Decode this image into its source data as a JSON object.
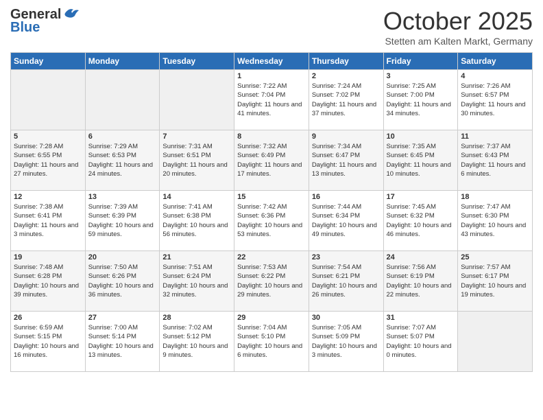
{
  "header": {
    "logo_general": "General",
    "logo_blue": "Blue",
    "month": "October 2025",
    "location": "Stetten am Kalten Markt, Germany"
  },
  "days_of_week": [
    "Sunday",
    "Monday",
    "Tuesday",
    "Wednesday",
    "Thursday",
    "Friday",
    "Saturday"
  ],
  "weeks": [
    [
      {
        "day": "",
        "sunrise": "",
        "sunset": "",
        "daylight": ""
      },
      {
        "day": "",
        "sunrise": "",
        "sunset": "",
        "daylight": ""
      },
      {
        "day": "",
        "sunrise": "",
        "sunset": "",
        "daylight": ""
      },
      {
        "day": "1",
        "sunrise": "Sunrise: 7:22 AM",
        "sunset": "Sunset: 7:04 PM",
        "daylight": "Daylight: 11 hours and 41 minutes."
      },
      {
        "day": "2",
        "sunrise": "Sunrise: 7:24 AM",
        "sunset": "Sunset: 7:02 PM",
        "daylight": "Daylight: 11 hours and 37 minutes."
      },
      {
        "day": "3",
        "sunrise": "Sunrise: 7:25 AM",
        "sunset": "Sunset: 7:00 PM",
        "daylight": "Daylight: 11 hours and 34 minutes."
      },
      {
        "day": "4",
        "sunrise": "Sunrise: 7:26 AM",
        "sunset": "Sunset: 6:57 PM",
        "daylight": "Daylight: 11 hours and 30 minutes."
      }
    ],
    [
      {
        "day": "5",
        "sunrise": "Sunrise: 7:28 AM",
        "sunset": "Sunset: 6:55 PM",
        "daylight": "Daylight: 11 hours and 27 minutes."
      },
      {
        "day": "6",
        "sunrise": "Sunrise: 7:29 AM",
        "sunset": "Sunset: 6:53 PM",
        "daylight": "Daylight: 11 hours and 24 minutes."
      },
      {
        "day": "7",
        "sunrise": "Sunrise: 7:31 AM",
        "sunset": "Sunset: 6:51 PM",
        "daylight": "Daylight: 11 hours and 20 minutes."
      },
      {
        "day": "8",
        "sunrise": "Sunrise: 7:32 AM",
        "sunset": "Sunset: 6:49 PM",
        "daylight": "Daylight: 11 hours and 17 minutes."
      },
      {
        "day": "9",
        "sunrise": "Sunrise: 7:34 AM",
        "sunset": "Sunset: 6:47 PM",
        "daylight": "Daylight: 11 hours and 13 minutes."
      },
      {
        "day": "10",
        "sunrise": "Sunrise: 7:35 AM",
        "sunset": "Sunset: 6:45 PM",
        "daylight": "Daylight: 11 hours and 10 minutes."
      },
      {
        "day": "11",
        "sunrise": "Sunrise: 7:37 AM",
        "sunset": "Sunset: 6:43 PM",
        "daylight": "Daylight: 11 hours and 6 minutes."
      }
    ],
    [
      {
        "day": "12",
        "sunrise": "Sunrise: 7:38 AM",
        "sunset": "Sunset: 6:41 PM",
        "daylight": "Daylight: 11 hours and 3 minutes."
      },
      {
        "day": "13",
        "sunrise": "Sunrise: 7:39 AM",
        "sunset": "Sunset: 6:39 PM",
        "daylight": "Daylight: 10 hours and 59 minutes."
      },
      {
        "day": "14",
        "sunrise": "Sunrise: 7:41 AM",
        "sunset": "Sunset: 6:38 PM",
        "daylight": "Daylight: 10 hours and 56 minutes."
      },
      {
        "day": "15",
        "sunrise": "Sunrise: 7:42 AM",
        "sunset": "Sunset: 6:36 PM",
        "daylight": "Daylight: 10 hours and 53 minutes."
      },
      {
        "day": "16",
        "sunrise": "Sunrise: 7:44 AM",
        "sunset": "Sunset: 6:34 PM",
        "daylight": "Daylight: 10 hours and 49 minutes."
      },
      {
        "day": "17",
        "sunrise": "Sunrise: 7:45 AM",
        "sunset": "Sunset: 6:32 PM",
        "daylight": "Daylight: 10 hours and 46 minutes."
      },
      {
        "day": "18",
        "sunrise": "Sunrise: 7:47 AM",
        "sunset": "Sunset: 6:30 PM",
        "daylight": "Daylight: 10 hours and 43 minutes."
      }
    ],
    [
      {
        "day": "19",
        "sunrise": "Sunrise: 7:48 AM",
        "sunset": "Sunset: 6:28 PM",
        "daylight": "Daylight: 10 hours and 39 minutes."
      },
      {
        "day": "20",
        "sunrise": "Sunrise: 7:50 AM",
        "sunset": "Sunset: 6:26 PM",
        "daylight": "Daylight: 10 hours and 36 minutes."
      },
      {
        "day": "21",
        "sunrise": "Sunrise: 7:51 AM",
        "sunset": "Sunset: 6:24 PM",
        "daylight": "Daylight: 10 hours and 32 minutes."
      },
      {
        "day": "22",
        "sunrise": "Sunrise: 7:53 AM",
        "sunset": "Sunset: 6:22 PM",
        "daylight": "Daylight: 10 hours and 29 minutes."
      },
      {
        "day": "23",
        "sunrise": "Sunrise: 7:54 AM",
        "sunset": "Sunset: 6:21 PM",
        "daylight": "Daylight: 10 hours and 26 minutes."
      },
      {
        "day": "24",
        "sunrise": "Sunrise: 7:56 AM",
        "sunset": "Sunset: 6:19 PM",
        "daylight": "Daylight: 10 hours and 22 minutes."
      },
      {
        "day": "25",
        "sunrise": "Sunrise: 7:57 AM",
        "sunset": "Sunset: 6:17 PM",
        "daylight": "Daylight: 10 hours and 19 minutes."
      }
    ],
    [
      {
        "day": "26",
        "sunrise": "Sunrise: 6:59 AM",
        "sunset": "Sunset: 5:15 PM",
        "daylight": "Daylight: 10 hours and 16 minutes."
      },
      {
        "day": "27",
        "sunrise": "Sunrise: 7:00 AM",
        "sunset": "Sunset: 5:14 PM",
        "daylight": "Daylight: 10 hours and 13 minutes."
      },
      {
        "day": "28",
        "sunrise": "Sunrise: 7:02 AM",
        "sunset": "Sunset: 5:12 PM",
        "daylight": "Daylight: 10 hours and 9 minutes."
      },
      {
        "day": "29",
        "sunrise": "Sunrise: 7:04 AM",
        "sunset": "Sunset: 5:10 PM",
        "daylight": "Daylight: 10 hours and 6 minutes."
      },
      {
        "day": "30",
        "sunrise": "Sunrise: 7:05 AM",
        "sunset": "Sunset: 5:09 PM",
        "daylight": "Daylight: 10 hours and 3 minutes."
      },
      {
        "day": "31",
        "sunrise": "Sunrise: 7:07 AM",
        "sunset": "Sunset: 5:07 PM",
        "daylight": "Daylight: 10 hours and 0 minutes."
      },
      {
        "day": "",
        "sunrise": "",
        "sunset": "",
        "daylight": ""
      }
    ]
  ]
}
